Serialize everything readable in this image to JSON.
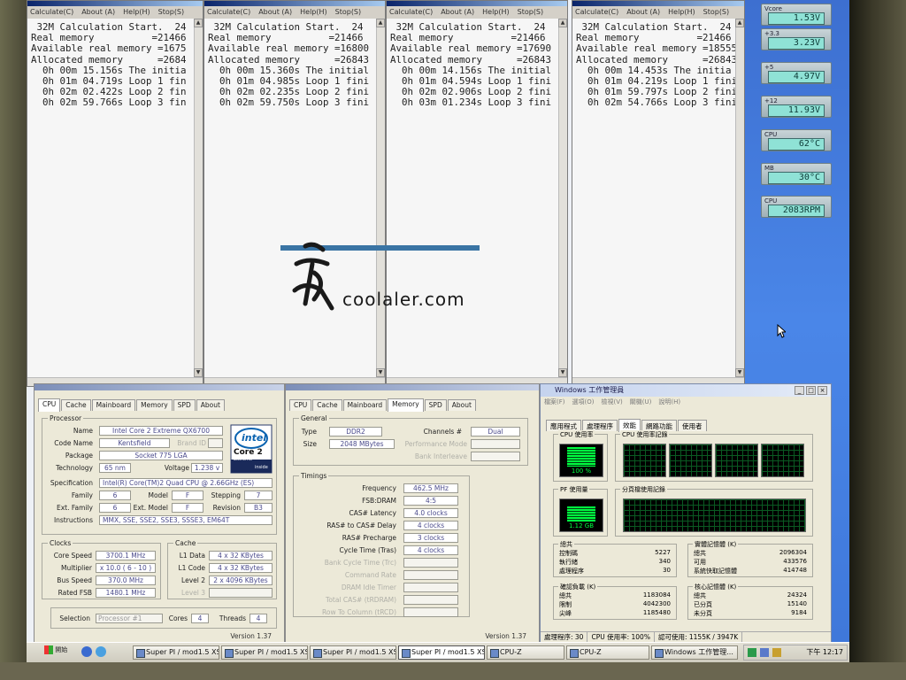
{
  "superpi": {
    "menu": [
      "Calculate(C)",
      "About (A)",
      "Help(H)",
      "Stop(S)"
    ],
    "windows": [
      {
        "lines": [
          " 32M Calculation Start.  24",
          "Real memory          =21466",
          "Available real memory =1675",
          "Allocated memory      =2684",
          "  0h 00m 15.156s The initia",
          "  0h 01m 04.719s Loop 1 fin",
          "  0h 02m 02.422s Loop 2 fin",
          "  0h 02m 59.766s Loop 3 fin"
        ]
      },
      {
        "lines": [
          " 32M Calculation Start.  24",
          "Real memory          =21466",
          "Available real memory =16800",
          "Allocated memory      =26843",
          "  0h 00m 15.360s The initial",
          "  0h 01m 04.985s Loop 1 fini",
          "  0h 02m 02.235s Loop 2 fini",
          "  0h 02m 59.750s Loop 3 fini"
        ]
      },
      {
        "lines": [
          " 32M Calculation Start.  24",
          "Real memory          =21466",
          "Available real memory =17690",
          "Allocated memory      =26843",
          "  0h 00m 14.156s The initial",
          "  0h 01m 04.594s Loop 1 fini",
          "  0h 02m 02.906s Loop 2 fini",
          "  0h 03m 01.234s Loop 3 fini"
        ]
      },
      {
        "lines": [
          " 32M Calculation Start.  24",
          "Real memory          =21466",
          "Available real memory =18555",
          "Allocated memory      =26843",
          "  0h 00m 14.453s The initia",
          "  0h 01m 04.219s Loop 1 fini",
          "  0h 01m 59.797s Loop 2 fini",
          "  0h 02m 54.766s Loop 3 fini"
        ]
      }
    ]
  },
  "gadgets": [
    {
      "label": "Vcore",
      "value": "1.53V"
    },
    {
      "label": "+3.3",
      "value": "3.23V"
    },
    {
      "label": "+5",
      "value": "4.97V"
    },
    {
      "label": "+12",
      "value": "11.93V"
    },
    {
      "label": "CPU",
      "value": "62°C"
    },
    {
      "label": "MB",
      "value": "30°C"
    },
    {
      "label": "CPU",
      "value": "2083RPM"
    }
  ],
  "watermark": {
    "text": "coolaler.com"
  },
  "cpuz_cpu": {
    "tabs": [
      "CPU",
      "Cache",
      "Mainboard",
      "Memory",
      "SPD",
      "About"
    ],
    "processor_legend": "Processor",
    "name_label": "Name",
    "name": "Intel Core 2 Extreme QX6700",
    "codename_label": "Code Name",
    "codename": "Kentsfield",
    "brandid_label": "Brand ID",
    "package_label": "Package",
    "package": "Socket 775 LGA",
    "technology_label": "Technology",
    "technology": "65 nm",
    "voltage_label": "Voltage",
    "voltage": "1.238 v",
    "spec_label": "Specification",
    "spec": "Intel(R) Core(TM)2 Quad CPU      @ 2.66GHz (ES)",
    "family_label": "Family",
    "family": "6",
    "model_label": "Model",
    "model": "F",
    "stepping_label": "Stepping",
    "stepping": "7",
    "extfamily_label": "Ext. Family",
    "extfamily": "6",
    "extmodel_label": "Ext. Model",
    "extmodel": "F",
    "revision_label": "Revision",
    "revision": "B3",
    "instructions_label": "Instructions",
    "instructions": "MMX, SSE, SSE2, SSE3, SSSE3, EM64T",
    "logo_brand": "intel",
    "logo_line1": "Core 2",
    "logo_line2": "Extreme",
    "logo_line3": "inside",
    "clocks_legend": "Clocks",
    "corespeed_label": "Core Speed",
    "corespeed": "3700.1 MHz",
    "multiplier_label": "Multiplier",
    "multiplier": "x 10.0 ( 6 - 10 )",
    "busspeed_label": "Bus Speed",
    "busspeed": "370.0 MHz",
    "ratedfsb_label": "Rated FSB",
    "ratedfsb": "1480.1 MHz",
    "cache_legend": "Cache",
    "l1data_label": "L1 Data",
    "l1data": "4 x 32 KBytes",
    "l1code_label": "L1 Code",
    "l1code": "4 x 32 KBytes",
    "level2_label": "Level 2",
    "level2": "2 x 4096 KBytes",
    "level3_label": "Level 3",
    "selection_label": "Selection",
    "selection": "Processor #1",
    "cores_label": "Cores",
    "cores": "4",
    "threads_label": "Threads",
    "threads": "4",
    "version": "Version 1.37"
  },
  "cpuz_mem": {
    "tabs": [
      "CPU",
      "Cache",
      "Mainboard",
      "Memory",
      "SPD",
      "About"
    ],
    "general_legend": "General",
    "type_label": "Type",
    "type": "DDR2",
    "channels_label": "Channels #",
    "channels": "Dual",
    "size_label": "Size",
    "size": "2048 MBytes",
    "perfmode_label": "Performance Mode",
    "bankinterleave_label": "Bank Interleave",
    "timings_legend": "Timings",
    "timings": [
      {
        "label": "Frequency",
        "value": "462.5 MHz",
        "dim": false
      },
      {
        "label": "FSB:DRAM",
        "value": "4:5",
        "dim": false
      },
      {
        "label": "CAS# Latency",
        "value": "4.0 clocks",
        "dim": false
      },
      {
        "label": "RAS# to CAS# Delay",
        "value": "4 clocks",
        "dim": false
      },
      {
        "label": "RAS# Precharge",
        "value": "3 clocks",
        "dim": false
      },
      {
        "label": "Cycle Time (Tras)",
        "value": "4 clocks",
        "dim": false
      },
      {
        "label": "Bank Cycle Time (Trc)",
        "value": "",
        "dim": true
      },
      {
        "label": "Command Rate",
        "value": "",
        "dim": true
      },
      {
        "label": "DRAM Idle Timer",
        "value": "",
        "dim": true
      },
      {
        "label": "Total CAS# (tRDRAM)",
        "value": "",
        "dim": true
      },
      {
        "label": "Row To Column (tRCD)",
        "value": "",
        "dim": true
      }
    ],
    "version": "Version 1.37"
  },
  "taskmgr": {
    "title": "Windows 工作管理員",
    "menu": [
      "檔案(F)",
      "選項(O)",
      "檢視(V)",
      "關機(U)",
      "說明(H)"
    ],
    "tabs": [
      "應用程式",
      "處理程序",
      "效能",
      "網路功能",
      "使用者"
    ],
    "cpu_usage_label": "CPU 使用率",
    "cpu_usage": "100 %",
    "cpu_history_label": "CPU 使用率記錄",
    "pf_usage_label": "PF 使用量",
    "pf_usage": "1.12 GB",
    "pf_history_label": "分頁檔使用記錄",
    "totals_label": "總共",
    "totals": [
      {
        "k": "控制碼",
        "v": "5227"
      },
      {
        "k": "執行緒",
        "v": "340"
      },
      {
        "k": "處理程序",
        "v": "30"
      }
    ],
    "physmem_label": "實體記憶體 (K)",
    "physmem": [
      {
        "k": "總共",
        "v": "2096304"
      },
      {
        "k": "可用",
        "v": "433576"
      },
      {
        "k": "系統快取記憶體",
        "v": "414748"
      }
    ],
    "commit_label": "確認負載 (K)",
    "commit": [
      {
        "k": "總共",
        "v": "1183084"
      },
      {
        "k": "限制",
        "v": "4042300"
      },
      {
        "k": "尖峰",
        "v": "1185480"
      }
    ],
    "kernel_label": "核心記憶體 (K)",
    "kernel": [
      {
        "k": "總共",
        "v": "24324"
      },
      {
        "k": "已分頁",
        "v": "15140"
      },
      {
        "k": "未分頁",
        "v": "9184"
      }
    ],
    "status": [
      "處理程序: 30",
      "CPU 使用率: 100%",
      "認可使用: 1155K / 3947K"
    ],
    "colors": {
      "graph_line": "#00ff40",
      "graph_bg": "#000000"
    }
  },
  "taskbar": {
    "start": "開始",
    "buttons": [
      "Super PI / mod1.5 XS",
      "Super PI / mod1.5 XS",
      "Super PI / mod1.5 XS",
      "Super PI / mod1.5 XS",
      "CPU-Z",
      "CPU-Z",
      "Windows 工作管理..."
    ],
    "clock": "下午 12:17"
  }
}
